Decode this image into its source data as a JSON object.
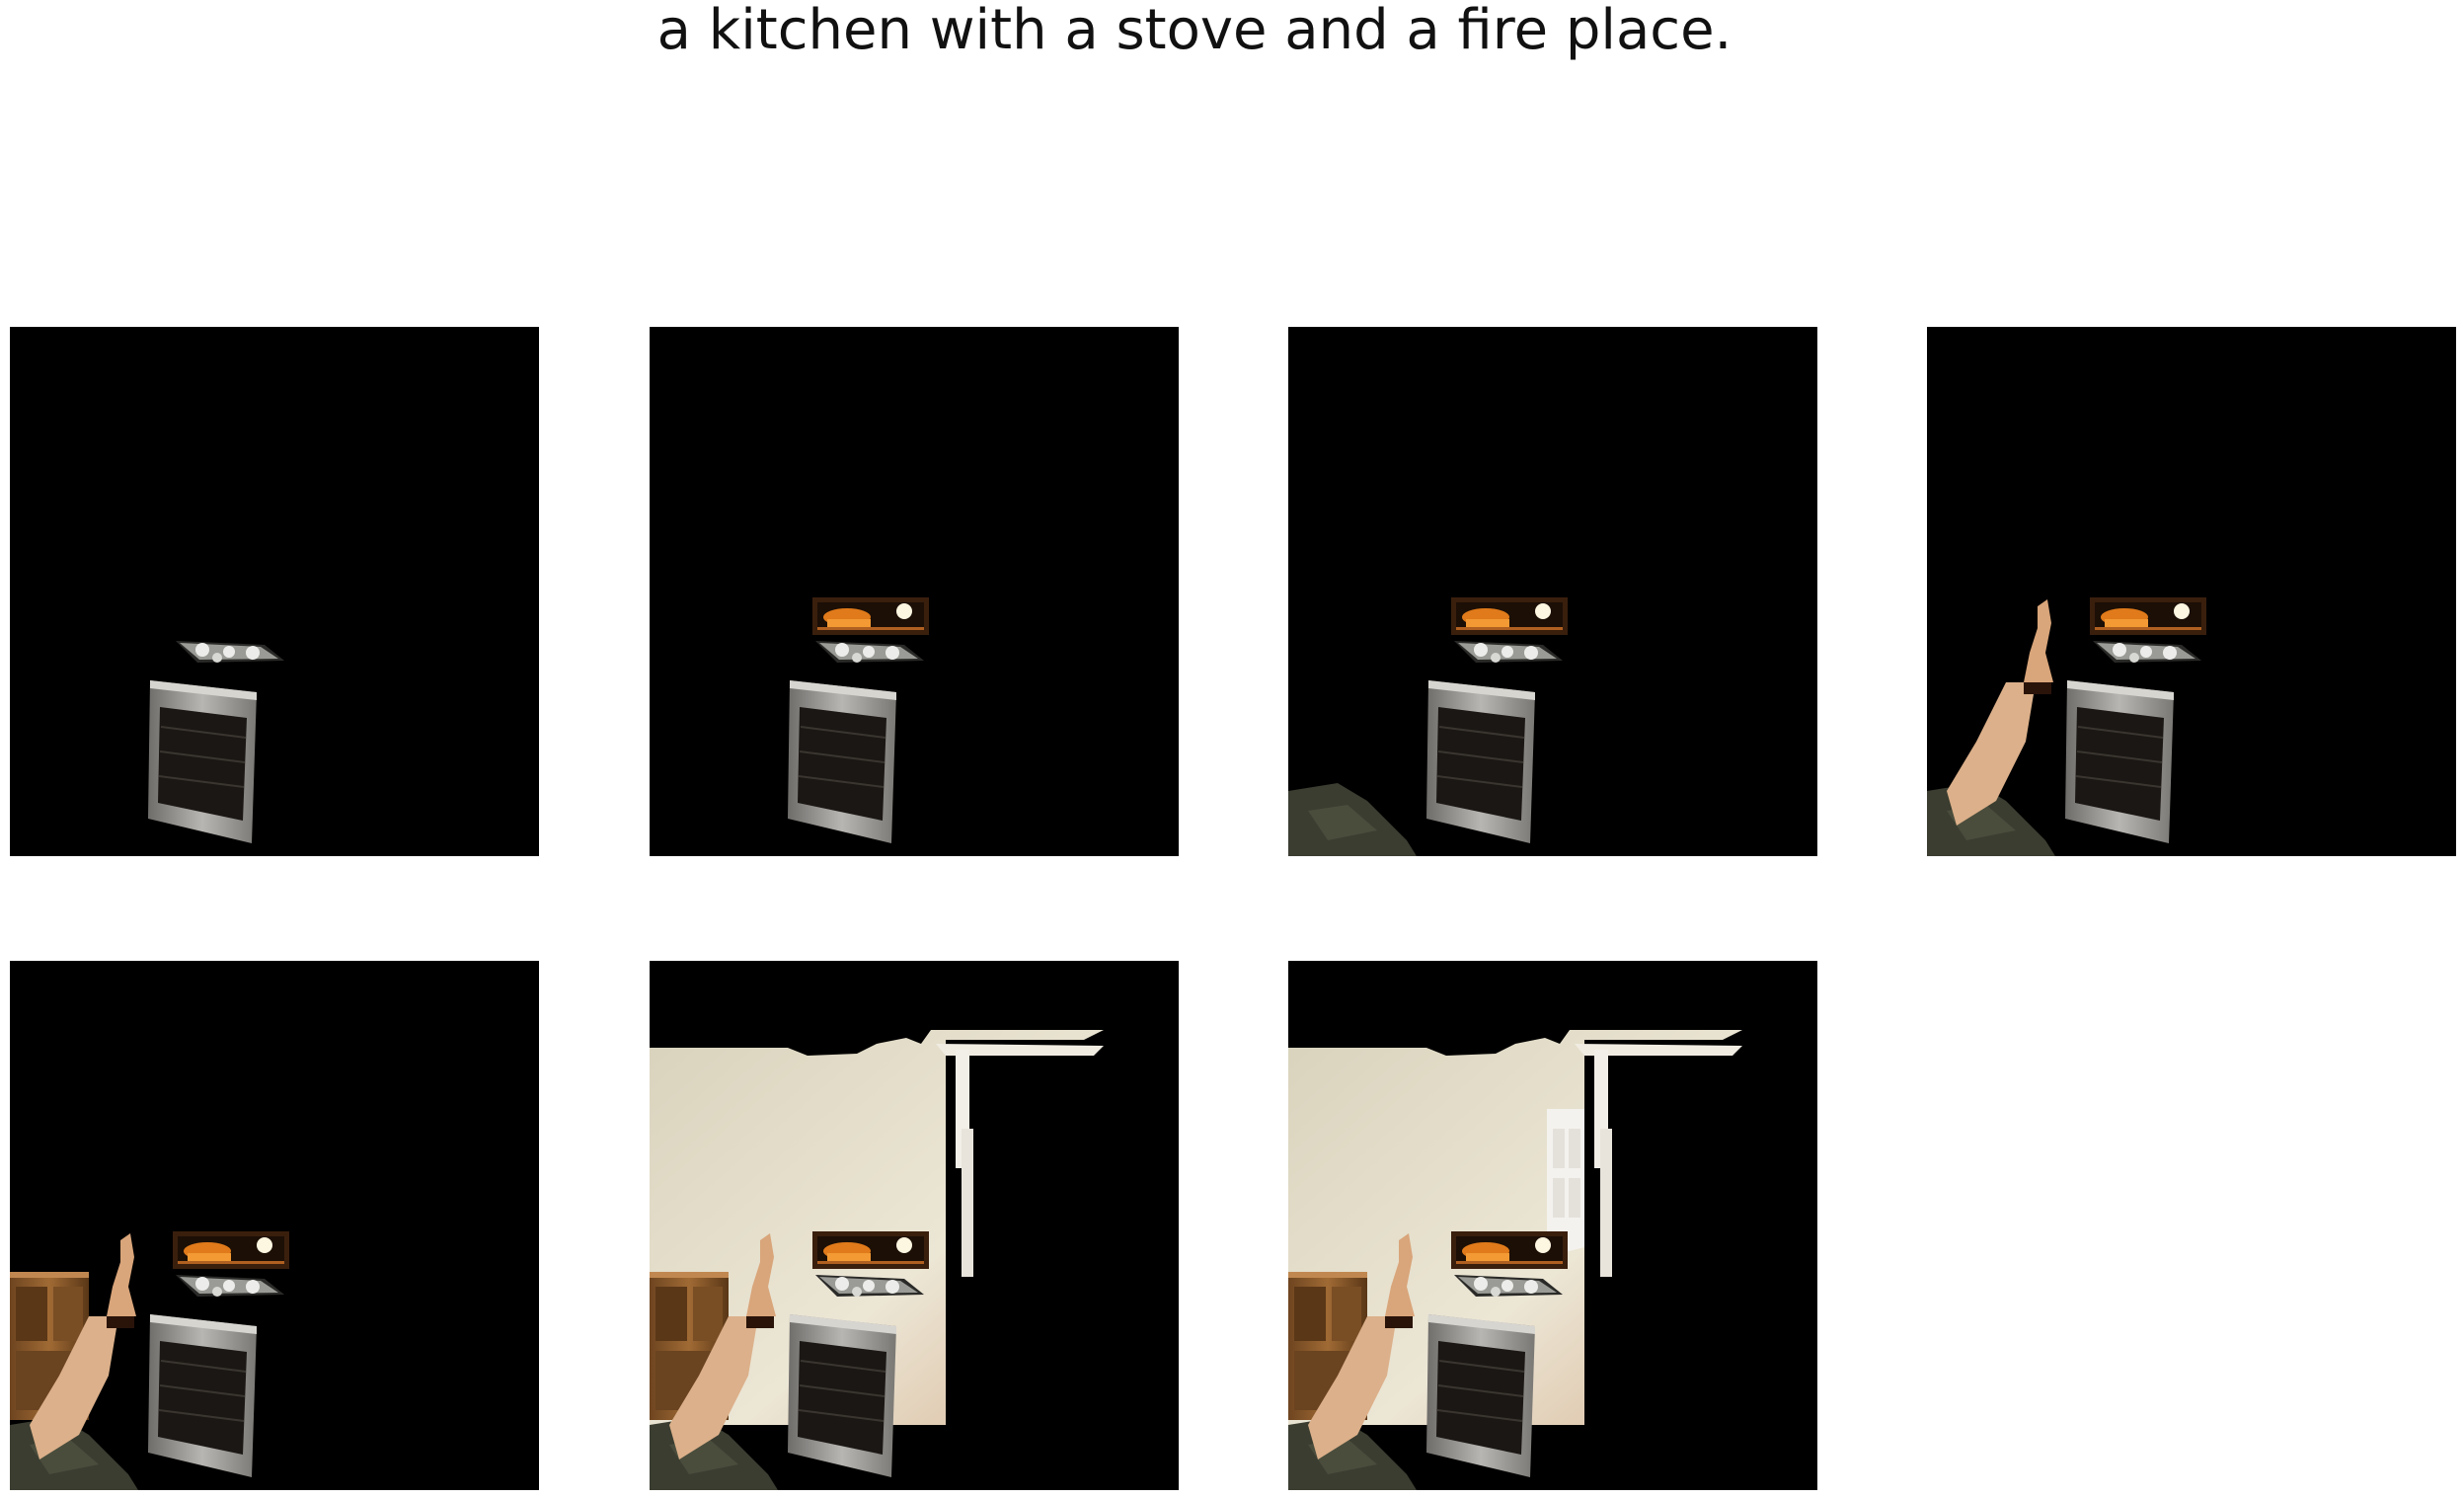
{
  "figure": {
    "title": "a kitchen with a stove and a fire place."
  },
  "panels": [
    {
      "step": 1,
      "objects": [
        "oven",
        "cooktop"
      ]
    },
    {
      "step": 2,
      "objects": [
        "oven",
        "cooktop",
        "cabinet-shelf"
      ]
    },
    {
      "step": 3,
      "objects": [
        "oven",
        "cooktop",
        "cabinet-shelf",
        "floor"
      ]
    },
    {
      "step": 4,
      "objects": [
        "oven",
        "cooktop",
        "cabinet-shelf",
        "floor",
        "counter"
      ]
    },
    {
      "step": 5,
      "objects": [
        "oven",
        "cooktop",
        "cabinet-shelf",
        "floor",
        "counter",
        "wooden-cabinet"
      ]
    },
    {
      "step": 6,
      "objects": [
        "oven",
        "cooktop",
        "cabinet-shelf",
        "floor",
        "counter",
        "wooden-cabinet",
        "wall",
        "ceiling-trim"
      ]
    },
    {
      "step": 7,
      "objects": [
        "oven",
        "cooktop",
        "cabinet-shelf",
        "floor",
        "counter",
        "wooden-cabinet",
        "wall",
        "ceiling-trim",
        "door"
      ]
    }
  ],
  "colors": {
    "background": "#000000",
    "oven_steel": "#8a8a88",
    "oven_glass": "#1a1714",
    "shelf_orange": "#e07a1a",
    "wall": "#e6e0cc",
    "floor": "#3a3d30",
    "counter": "#d9a57a",
    "cabinet_wood": "#8a5a2b",
    "door": "#f4f2ee"
  }
}
